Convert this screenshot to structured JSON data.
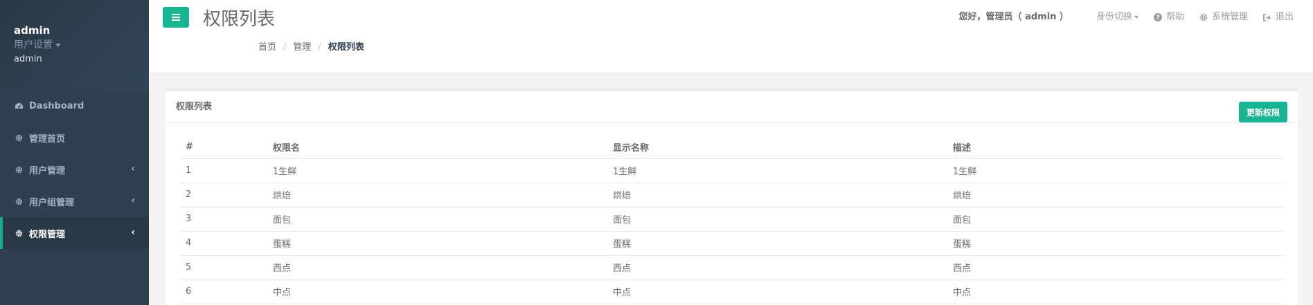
{
  "sidebar": {
    "profile": {
      "name": "admin",
      "settings_label": "用户设置",
      "role": "admin"
    },
    "items": [
      {
        "label": "Dashboard",
        "icon": "dashboard-icon",
        "has_arrow": false
      },
      {
        "label": "管理首页",
        "icon": "gear-icon",
        "has_arrow": false
      },
      {
        "label": "用户管理",
        "icon": "gear-icon",
        "has_arrow": true
      },
      {
        "label": "用户组管理",
        "icon": "gear-icon",
        "has_arrow": true
      },
      {
        "label": "权限管理",
        "icon": "gear-icon",
        "has_arrow": true,
        "active": true
      }
    ],
    "arrow_glyph": "‹"
  },
  "header": {
    "title": "权限列表",
    "breadcrumb": [
      "首页",
      "管理",
      "权限列表"
    ],
    "greeting": "您好，管理员（ admin ）",
    "identity_switch": "身份切换",
    "help": "帮助",
    "system": "系统管理",
    "logout": "退出"
  },
  "panel": {
    "title": "权限列表",
    "update_button": "更新权限",
    "columns": [
      "#",
      "权限名",
      "显示名称",
      "描述"
    ],
    "rows": [
      [
        "1",
        "1生鲜",
        "1生鲜",
        "1生鲜"
      ],
      [
        "2",
        "烘焙",
        "烘焙",
        "烘焙"
      ],
      [
        "3",
        "面包",
        "面包",
        "面包"
      ],
      [
        "4",
        "蛋糕",
        "蛋糕",
        "蛋糕"
      ],
      [
        "5",
        "西点",
        "西点",
        "西点"
      ],
      [
        "6",
        "中点",
        "中点",
        "中点"
      ]
    ]
  },
  "colors": {
    "accent": "#1ab394",
    "sidebar": "#2f4050",
    "sidebar_active": "#293846"
  }
}
